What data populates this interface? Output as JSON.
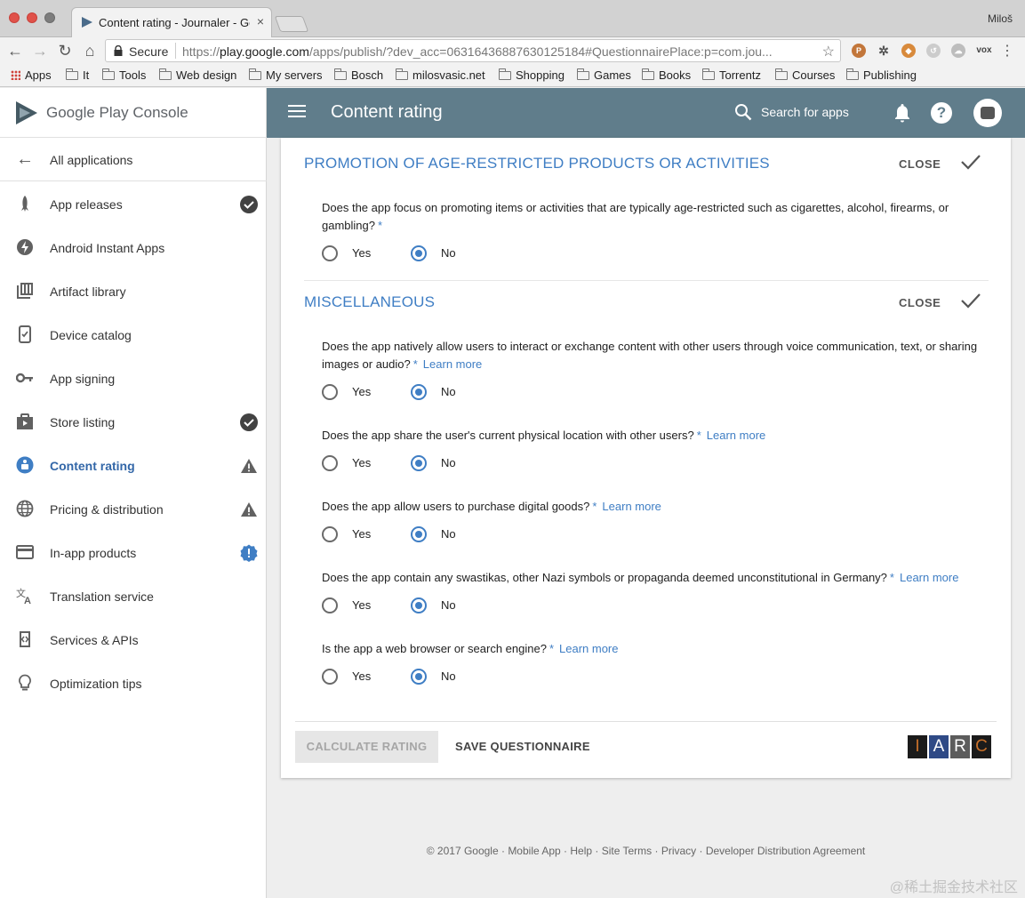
{
  "browser": {
    "tab_title": "Content rating - Journaler - Google Play Console",
    "tab_close": "×",
    "profile_name": "Miloš",
    "secure_label": "Secure",
    "url_scheme": "https://",
    "url_host": "play.google.com",
    "url_rest": "/apps/publish/?dev_acc=06316436887630125184#QuestionnairePlace:p=com.jou...",
    "ext_vox": "vox",
    "bookmarks": [
      "Apps",
      "It",
      "Tools",
      "Web design",
      "My servers",
      "Bosch",
      "milosvasic.net",
      "Shopping",
      "Games",
      "Books",
      "Torrentz",
      "Courses",
      "Publishing"
    ]
  },
  "sidebar": {
    "brand": "Google Play Console",
    "all_apps": "All applications",
    "items": [
      {
        "label": "App releases",
        "icon": "rocket-icon",
        "status": "check"
      },
      {
        "label": "Android Instant Apps",
        "icon": "bolt-icon",
        "status": ""
      },
      {
        "label": "Artifact library",
        "icon": "library-icon",
        "status": ""
      },
      {
        "label": "Device catalog",
        "icon": "device-icon",
        "status": ""
      },
      {
        "label": "App signing",
        "icon": "key-icon",
        "status": ""
      },
      {
        "label": "Store listing",
        "icon": "store-icon",
        "status": "check"
      },
      {
        "label": "Content rating",
        "icon": "content-rating-icon",
        "status": "warning",
        "active": true
      },
      {
        "label": "Pricing & distribution",
        "icon": "globe-icon",
        "status": "warning"
      },
      {
        "label": "In-app products",
        "icon": "card-icon",
        "status": "info"
      },
      {
        "label": "Translation service",
        "icon": "translate-icon",
        "status": ""
      },
      {
        "label": "Services & APIs",
        "icon": "api-icon",
        "status": ""
      },
      {
        "label": "Optimization tips",
        "icon": "lightbulb-icon",
        "status": ""
      }
    ]
  },
  "appbar": {
    "title": "Content rating",
    "search_label": "Search for apps",
    "help": "?"
  },
  "sections": [
    {
      "title": "PROMOTION OF AGE-RESTRICTED PRODUCTS OR ACTIVITIES",
      "close_label": "CLOSE",
      "questions": [
        {
          "text": "Does the app focus on promoting items or activities that are typically age-restricted such as cigarettes, alcohol, firearms, or gambling?",
          "learn": "",
          "selected": "No"
        }
      ]
    },
    {
      "title": "MISCELLANEOUS",
      "close_label": "CLOSE",
      "questions": [
        {
          "text": "Does the app natively allow users to interact or exchange content with other users through voice communication, text, or sharing images or audio?",
          "learn": "Learn more",
          "selected": "No"
        },
        {
          "text": "Does the app share the user's current physical location with other users?",
          "learn": "Learn more",
          "selected": "No"
        },
        {
          "text": "Does the app allow users to purchase digital goods?",
          "learn": "Learn more",
          "selected": "No"
        },
        {
          "text": "Does the app contain any swastikas, other Nazi symbols or propaganda deemed unconstitutional in Germany?",
          "learn": "Learn more",
          "selected": "No"
        },
        {
          "text": "Is the app a web browser or search engine?",
          "learn": "Learn more",
          "selected": "No"
        }
      ]
    }
  ],
  "options": {
    "yes": "Yes",
    "no": "No"
  },
  "required_mark": "*",
  "actions": {
    "calculate": "CALCULATE RATING",
    "save": "SAVE QUESTIONNAIRE"
  },
  "iarc_letters": [
    "I",
    "A",
    "R",
    "C"
  ],
  "footer": "© 2017 Google · Mobile App · Help · Site Terms · Privacy · Developer Distribution Agreement",
  "watermark": "@稀土掘金技术社区",
  "colors": {
    "appbar": "#607d8b",
    "accent": "#3f7ec4",
    "iarc": [
      "#1b1b1b",
      "#2f4a86",
      "#5c5c5c",
      "#c8702a"
    ]
  }
}
